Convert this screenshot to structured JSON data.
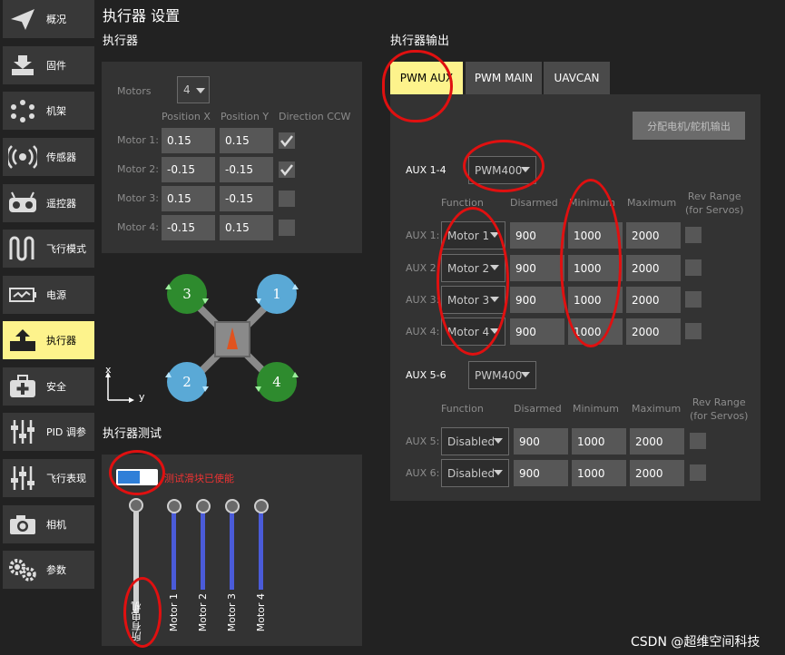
{
  "sidebar": {
    "items": [
      {
        "label": "概况",
        "icon": "paper-plane-icon"
      },
      {
        "label": "固件",
        "icon": "download-icon"
      },
      {
        "label": "机架",
        "icon": "airframe-icon"
      },
      {
        "label": "传感器",
        "icon": "sensor-icon"
      },
      {
        "label": "遥控器",
        "icon": "remote-control-icon"
      },
      {
        "label": "飞行模式",
        "icon": "flight-mode-icon"
      },
      {
        "label": "电源",
        "icon": "battery-icon"
      },
      {
        "label": "执行器",
        "icon": "actuator-icon"
      },
      {
        "label": "安全",
        "icon": "first-aid-icon"
      },
      {
        "label": "PID 调参",
        "icon": "sliders-icon"
      },
      {
        "label": "飞行表现",
        "icon": "sliders-icon"
      },
      {
        "label": "相机",
        "icon": "camera-icon"
      },
      {
        "label": "参数",
        "icon": "gears-icon"
      }
    ],
    "active_index": 7
  },
  "page_title": "执行器 设置",
  "actuators": {
    "heading": "执行器",
    "motors_label": "Motors",
    "motors_value": "4",
    "col_x": "Position X",
    "col_y": "Position Y",
    "col_dir": "Direction CCW",
    "rows": [
      {
        "label": "Motor 1:",
        "x": "0.15",
        "y": "0.15",
        "ccw": true
      },
      {
        "label": "Motor 2:",
        "x": "-0.15",
        "y": "-0.15",
        "ccw": true
      },
      {
        "label": "Motor 3:",
        "x": "0.15",
        "y": "-0.15",
        "ccw": false
      },
      {
        "label": "Motor 4:",
        "x": "-0.15",
        "y": "0.15",
        "ccw": false
      }
    ]
  },
  "diagram": {
    "rotors": [
      "3",
      "1",
      "2",
      "4"
    ],
    "axis_x": "x",
    "axis_y": "y"
  },
  "test": {
    "heading": "执行器测试",
    "enabled_text": "测试滑块已使能",
    "sliders": [
      "所有电机",
      "Motor 1",
      "Motor 2",
      "Motor 3",
      "Motor 4"
    ]
  },
  "output": {
    "heading": "执行器输出",
    "tabs": [
      "PWM AUX",
      "PWM MAIN",
      "UAVCAN"
    ],
    "assign_button": "分配电机/舵机输出",
    "group1": {
      "label": "AUX 1-4",
      "protocol": "PWM400",
      "headers": [
        "Function",
        "Disarmed",
        "Minimum",
        "Maximum",
        "Rev Range\n(for Servos)"
      ],
      "rows": [
        {
          "label": "AUX 1:",
          "function": "Motor 1",
          "disarmed": "900",
          "min": "1000",
          "max": "2000"
        },
        {
          "label": "AUX 2:",
          "function": "Motor 2",
          "disarmed": "900",
          "min": "1000",
          "max": "2000"
        },
        {
          "label": "AUX 3:",
          "function": "Motor 3",
          "disarmed": "900",
          "min": "1000",
          "max": "2000"
        },
        {
          "label": "AUX 4:",
          "function": "Motor 4",
          "disarmed": "900",
          "min": "1000",
          "max": "2000"
        }
      ]
    },
    "group2": {
      "label": "AUX 5-6",
      "protocol": "PWM400",
      "headers": [
        "Function",
        "Disarmed",
        "Minimum",
        "Maximum",
        "Rev Range\n(for Servos)"
      ],
      "rows": [
        {
          "label": "AUX 5:",
          "function": "Disabled",
          "disarmed": "900",
          "min": "1000",
          "max": "2000"
        },
        {
          "label": "AUX 6:",
          "function": "Disabled",
          "disarmed": "900",
          "min": "1000",
          "max": "2000"
        }
      ]
    }
  },
  "watermark": "CSDN @超维空间科技",
  "colors": {
    "active_nav": "#fdf38c",
    "slider": "#4a5bd9",
    "rotor_green": "#2e8b2e",
    "rotor_blue": "#5aa9d6",
    "annotation_red": "#e01010"
  }
}
